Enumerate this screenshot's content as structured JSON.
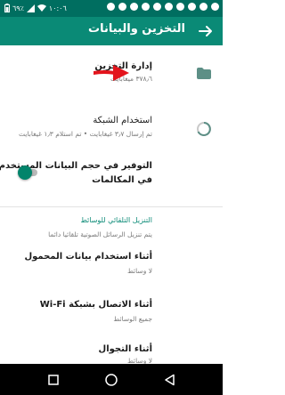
{
  "status_bar": {
    "time": "١٠:٠٦",
    "battery": "٦٩٪"
  },
  "app_bar": {
    "title": "التخزين والبيانات",
    "back_icon": "arrow-right-icon"
  },
  "storage": {
    "title": "إدارة التخزين",
    "subtitle": "٣٧٨٫٦ ميغابايت",
    "icon": "folder-icon"
  },
  "network": {
    "title": "استخدام الشبكة",
    "subtitle": "تم إرسال ٣٫٧ غيغابايت • تم استلام ١٫٣ غيغابايت",
    "icon": "data-usage-icon"
  },
  "low_data": {
    "title_line1": "التوفير في حجم البيانات المستخدم",
    "title_line2": "في المكالمات",
    "enabled": false
  },
  "auto_download": {
    "header": "التنزيل التلقائي للوسائط",
    "note": "يتم تنزيل الرسائل الصوتية تلقائيا دائما",
    "items": [
      {
        "title": "أثناء استخدام بيانات المحمول",
        "subtitle": "لا وسائط"
      },
      {
        "title": "أثناء الاتصال بشبكة Wi-Fi",
        "subtitle": "جميع الوسائط"
      },
      {
        "title": "أثناء التجوال",
        "subtitle": "لا وسائط"
      }
    ]
  },
  "colors": {
    "status_bar": "#006e60",
    "app_bar": "#0a8a76",
    "accent": "#0a8a76",
    "annotation_arrow": "#e3141c"
  }
}
